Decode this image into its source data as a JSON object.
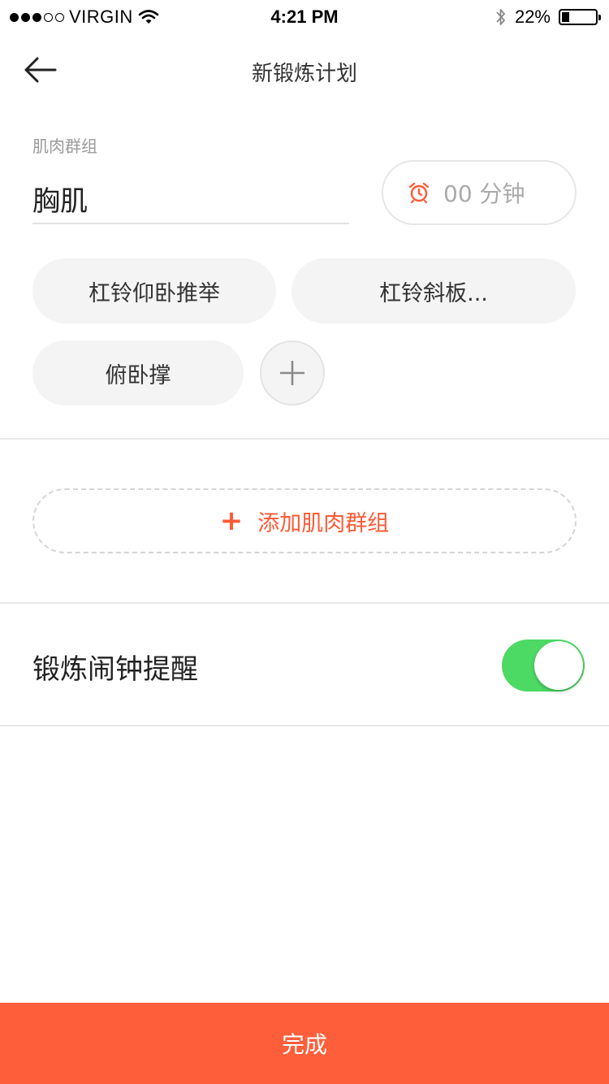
{
  "status_bar": {
    "signal_filled": 3,
    "signal_total": 5,
    "carrier": "VIRGIN",
    "time": "4:21 PM",
    "battery_percent": "22%",
    "battery_level": 0.22,
    "icons": [
      "wifi-icon",
      "bluetooth-icon",
      "battery-icon"
    ]
  },
  "nav": {
    "title": "新锻炼计划",
    "back_icon": "arrow-left-icon"
  },
  "muscle_group": {
    "label": "肌肉群组",
    "value": "胸肌",
    "duration": "00 分钟",
    "duration_icon": "alarm-clock-icon"
  },
  "exercises": [
    {
      "label": "杠铃仰卧推举"
    },
    {
      "label": "杠铃斜板..."
    },
    {
      "label": "俯卧撑"
    }
  ],
  "add_exercise_icon": "plus-icon",
  "add_group": {
    "plus": "+",
    "label": "添加肌肉群组"
  },
  "reminder": {
    "label": "锻炼闹钟提醒",
    "enabled": true
  },
  "done_button": {
    "label": "完成"
  },
  "colors": {
    "accent": "#ff5e3a",
    "accent_text": "#ff5a36",
    "toggle_on": "#4cd964",
    "chip_bg": "#f4f4f4"
  }
}
